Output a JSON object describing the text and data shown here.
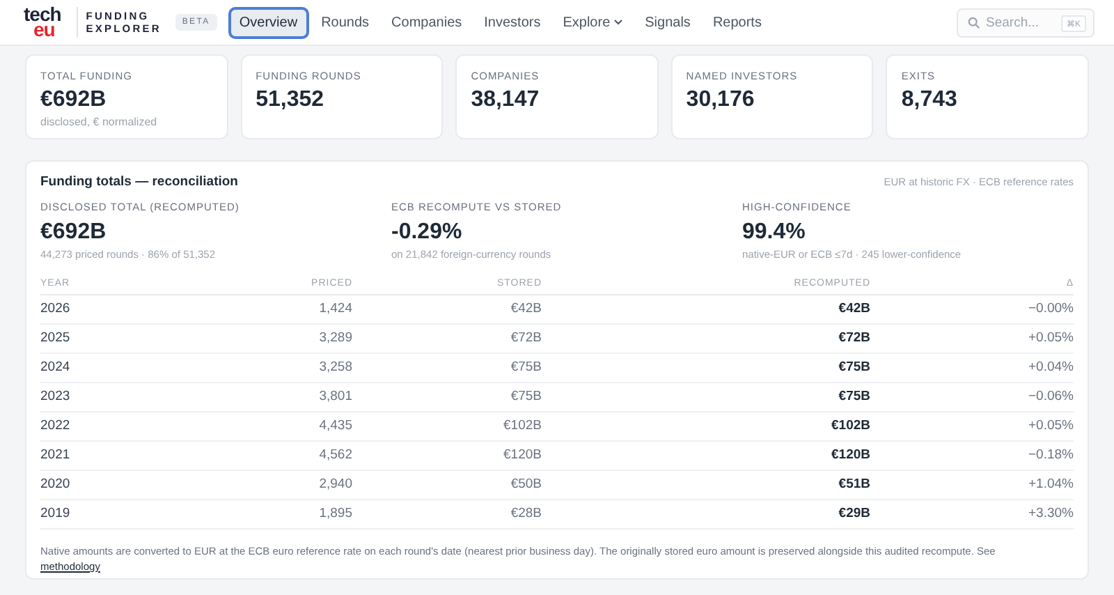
{
  "nav": {
    "logo": {
      "top": "tech",
      "bottom": "eu"
    },
    "product": [
      "FUNDING",
      "EXPLORER"
    ],
    "badge": "BETA",
    "tabs": [
      {
        "label": "Overview",
        "selected": true,
        "dropdown": false
      },
      {
        "label": "Rounds",
        "selected": false,
        "dropdown": false
      },
      {
        "label": "Companies",
        "selected": false,
        "dropdown": false
      },
      {
        "label": "Investors",
        "selected": false,
        "dropdown": false
      },
      {
        "label": "Explore",
        "selected": false,
        "dropdown": true
      },
      {
        "label": "Signals",
        "selected": false,
        "dropdown": false
      },
      {
        "label": "Reports",
        "selected": false,
        "dropdown": false
      }
    ],
    "search": {
      "placeholder": "Search...",
      "shortcut": "⌘K"
    }
  },
  "stats": [
    {
      "label": "TOTAL FUNDING",
      "value": "€692B",
      "note": "disclosed, € normalized"
    },
    {
      "label": "FUNDING ROUNDS",
      "value": "51,352"
    },
    {
      "label": "COMPANIES",
      "value": "38,147"
    },
    {
      "label": "NAMED INVESTORS",
      "value": "30,176"
    },
    {
      "label": "EXITS",
      "value": "8,743"
    }
  ],
  "panel": {
    "title": "Funding totals — reconciliation",
    "source": "EUR at historic FX · ECB reference rates",
    "metrics": [
      {
        "label": "DISCLOSED TOTAL (RECOMPUTED)",
        "value": "€692B",
        "note": "44,273 priced rounds · 86% of 51,352"
      },
      {
        "label": "ECB RECOMPUTE VS STORED",
        "value": "-0.29%",
        "note": "on 21,842 foreign-currency rounds"
      },
      {
        "label": "HIGH-CONFIDENCE",
        "value": "99.4%",
        "note": "native-EUR or ECB ≤7d · 245 lower-confidence"
      }
    ],
    "table": {
      "columns": [
        "YEAR",
        "PRICED",
        "STORED",
        "RECOMPUTED",
        "Δ"
      ],
      "rows": [
        [
          "2026",
          "1,424",
          "€42B",
          "€42B",
          "−0.00%"
        ],
        [
          "2025",
          "3,289",
          "€72B",
          "€72B",
          "+0.05%"
        ],
        [
          "2024",
          "3,258",
          "€75B",
          "€75B",
          "+0.04%"
        ],
        [
          "2023",
          "3,801",
          "€75B",
          "€75B",
          "−0.06%"
        ],
        [
          "2022",
          "4,435",
          "€102B",
          "€102B",
          "+0.05%"
        ],
        [
          "2021",
          "4,562",
          "€120B",
          "€120B",
          "−0.18%"
        ],
        [
          "2020",
          "2,940",
          "€50B",
          "€51B",
          "+1.04%"
        ],
        [
          "2019",
          "1,895",
          "€28B",
          "€29B",
          "+3.30%"
        ]
      ]
    },
    "footnote": {
      "text": "Native amounts are converted to EUR at the ECB euro reference rate on each round's date (nearest prior business day). The originally stored euro amount is preserved alongside this audited recompute. See ",
      "link": "methodology"
    }
  }
}
